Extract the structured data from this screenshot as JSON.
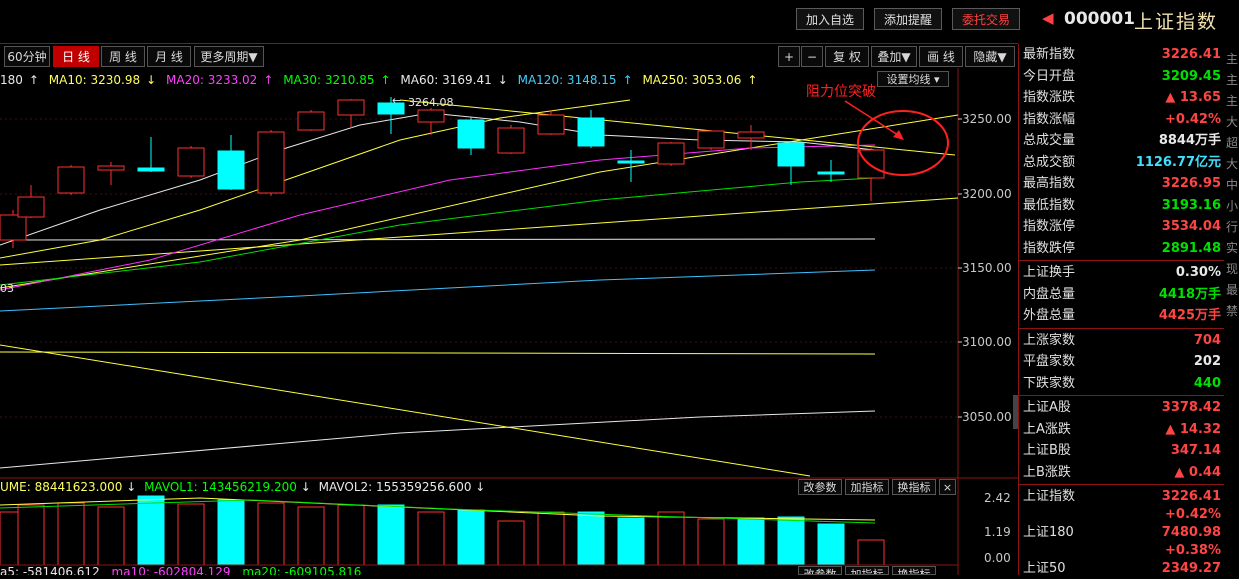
{
  "toolbar": {
    "add_watch": "加入自选",
    "add_alert": "添加提醒",
    "trade": "委托交易"
  },
  "header": {
    "code": "000001",
    "name": "上证指数"
  },
  "periods": {
    "min60": "60分钟",
    "day": "日 线",
    "week": "周 线",
    "month": "月 线",
    "more": "更多周期▼"
  },
  "chart_tools": {
    "plus": "+",
    "minus": "−",
    "restore": "复 权",
    "overlay": "叠加▼",
    "draw": "画 线",
    "hide": "隐藏▼",
    "ma_settings": "设置均线 ▾"
  },
  "ma_legend": {
    "ma5": "180",
    "ma10": "MA10: 3230.98",
    "ma20": "MA20: 3233.02",
    "ma30": "MA30: 3210.85",
    "ma60": "MA60: 3169.41",
    "ma120": "MA120: 3148.15",
    "ma250": "MA250: 3053.06"
  },
  "annotation": {
    "text": "阻力位突破",
    "high_label": "3264.08",
    "left_label": "03"
  },
  "price_axis": [
    "3250.00",
    "3200.00",
    "3150.00",
    "3100.00",
    "3050.00"
  ],
  "vol_legend": {
    "volume": "UME: 88441623.000",
    "mavol1": "MAVOL1: 143456219.200",
    "mavol2": "MAVOL2: 155359256.600"
  },
  "vol_axis": [
    "2.42",
    "1.19",
    "0.00"
  ],
  "vol_tools": {
    "change": "改参数",
    "add": "加指标",
    "swap": "换指标",
    "close": "×"
  },
  "bottom_legend": {
    "ma5": "a5: -581406.612",
    "ma10": "ma10: -602804.129",
    "ma20": "ma20: -609105.816"
  },
  "quote": [
    {
      "label": "最新指数",
      "value": "3226.41",
      "cls": "up"
    },
    {
      "label": "今日开盘",
      "value": "3209.45",
      "cls": "dn"
    },
    {
      "label": "指数涨跌",
      "value": "▲ 13.65",
      "cls": "up"
    },
    {
      "label": "指数涨幅",
      "value": "+0.42%",
      "cls": "up"
    },
    {
      "label": "总成交量",
      "value": "8844万手",
      "cls": "wh"
    },
    {
      "label": "总成交额",
      "value": "1126.77亿元",
      "cls": "cy"
    },
    {
      "label": "最高指数",
      "value": "3226.95",
      "cls": "up"
    },
    {
      "label": "最低指数",
      "value": "3193.16",
      "cls": "dn"
    },
    {
      "label": "指数涨停",
      "value": "3534.04",
      "cls": "up"
    },
    {
      "label": "指数跌停",
      "value": "2891.48",
      "cls": "dn"
    }
  ],
  "quote2": [
    {
      "label": "上证换手",
      "value": "0.30%",
      "cls": "wh"
    },
    {
      "label": "内盘总量",
      "value": "4418万手",
      "cls": "dn"
    },
    {
      "label": "外盘总量",
      "value": "4425万手",
      "cls": "up"
    }
  ],
  "quote3": [
    {
      "label": "上涨家数",
      "value": "704",
      "cls": "up"
    },
    {
      "label": "平盘家数",
      "value": "202",
      "cls": "wh"
    },
    {
      "label": "下跌家数",
      "value": "440",
      "cls": "dn"
    }
  ],
  "quote4": [
    {
      "label": "上证A股",
      "value": "3378.42",
      "cls": "up"
    },
    {
      "label": "上A涨跌",
      "value": "▲ 14.32",
      "cls": "up"
    },
    {
      "label": "上证B股",
      "value": "347.14",
      "cls": "up"
    },
    {
      "label": "上B涨跌",
      "value": "▲ 0.44",
      "cls": "up"
    }
  ],
  "quote5": [
    {
      "label": "上证指数",
      "value": "3226.41",
      "cls": "up"
    },
    {
      "label": "",
      "value": "+0.42%",
      "cls": "up"
    },
    {
      "label": "上证180",
      "value": "7480.98",
      "cls": "up"
    },
    {
      "label": "",
      "value": "+0.38%",
      "cls": "up"
    },
    {
      "label": "上证50",
      "value": "2349.27",
      "cls": "up"
    }
  ],
  "edge_chars": [
    "主",
    "主",
    "主",
    "大",
    "超",
    "大",
    "中",
    "小",
    "行",
    "实",
    "现",
    "最",
    "禁"
  ],
  "colors": {
    "up": "#ff3030",
    "down": "#00ffff",
    "ma10": "#e8e8e8",
    "ma20": "#ff30ff",
    "ma30": "#00ff00",
    "ma60": "#ffff40",
    "ma120": "#40c0ff",
    "ma250": "#ffff40"
  }
}
